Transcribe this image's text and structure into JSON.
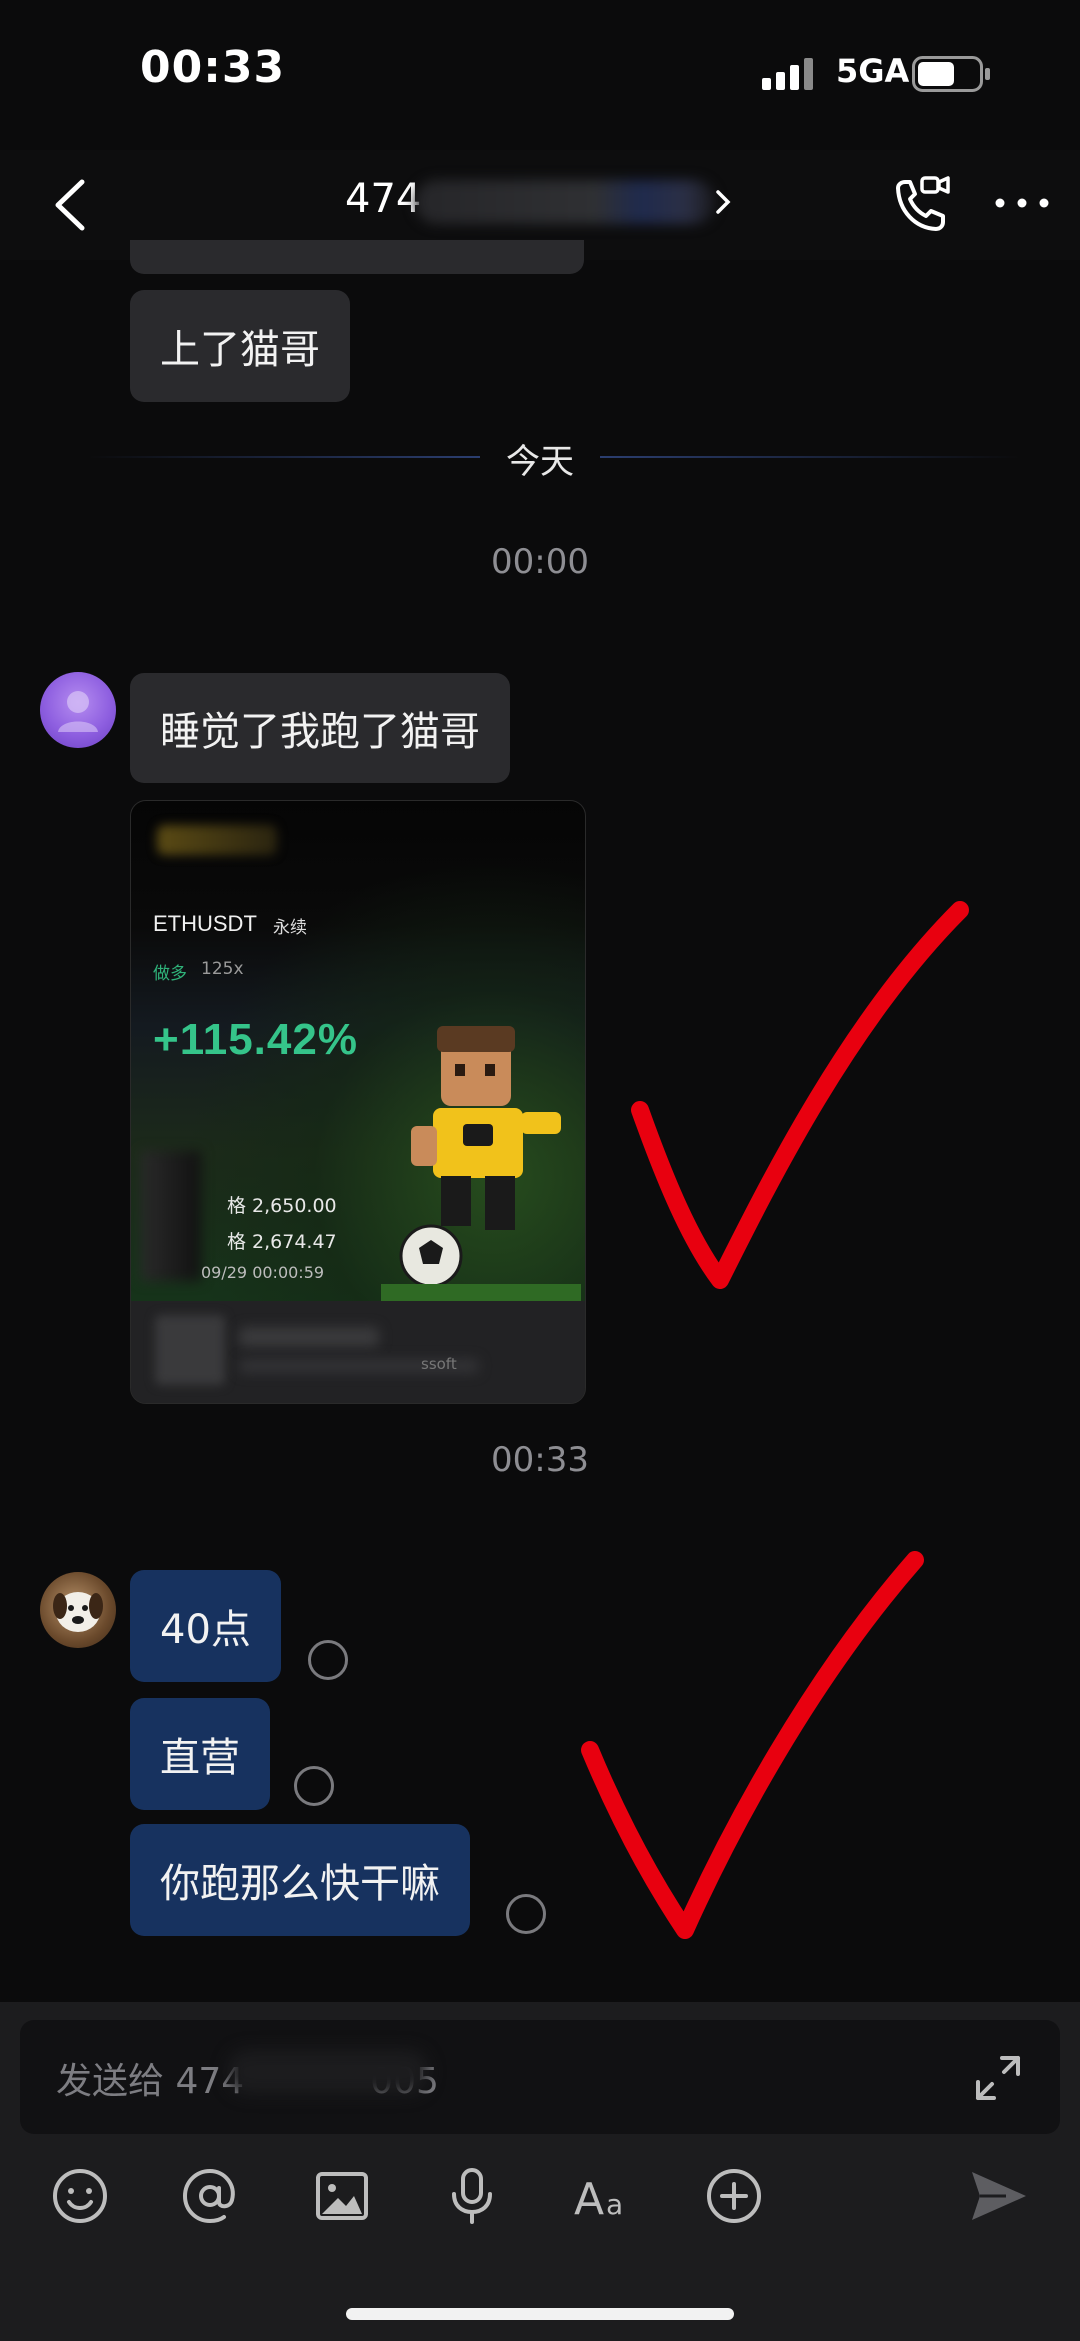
{
  "status_bar": {
    "time": "00:33",
    "network": "5GA",
    "signal_bars": 4,
    "battery_level": 0.55
  },
  "header": {
    "title": "474",
    "back_icon": "chevron-left-icon",
    "call_icon": "phone-video-icon",
    "more_icon": "more-horizontal-icon"
  },
  "date_divider": "今天",
  "messages": [
    {
      "text": "上了猫哥"
    },
    {
      "timestamp": "00:00"
    },
    {
      "text": "睡觉了我跑了猫哥"
    },
    {
      "image_card": {
        "pair": "ETHUSDT",
        "contract": "永续",
        "side": "做多",
        "leverage": "125x",
        "gain": "+115.42%",
        "entry": "格 2,650.00",
        "mark": "格 2,674.47",
        "date": "09/29 00:00:59",
        "footer_tail": "ssoft"
      }
    },
    {
      "timestamp": "00:33"
    },
    {
      "text": "40点"
    },
    {
      "text": "直营"
    },
    {
      "text": "你跑那么快干嘛"
    }
  ],
  "composer": {
    "placeholder": "发送给 474",
    "placeholder_tail": "005",
    "tools": [
      "emoji-icon",
      "mention-icon",
      "image-icon",
      "microphone-icon",
      "text-format-icon",
      "plus-circle-icon",
      "send-icon"
    ]
  },
  "colors": {
    "background": "#0b0b0c",
    "bubble": "#2a2a2d",
    "bubble_mine": "#17325f",
    "gain": "#35c48a",
    "annotation": "#e8000f"
  }
}
